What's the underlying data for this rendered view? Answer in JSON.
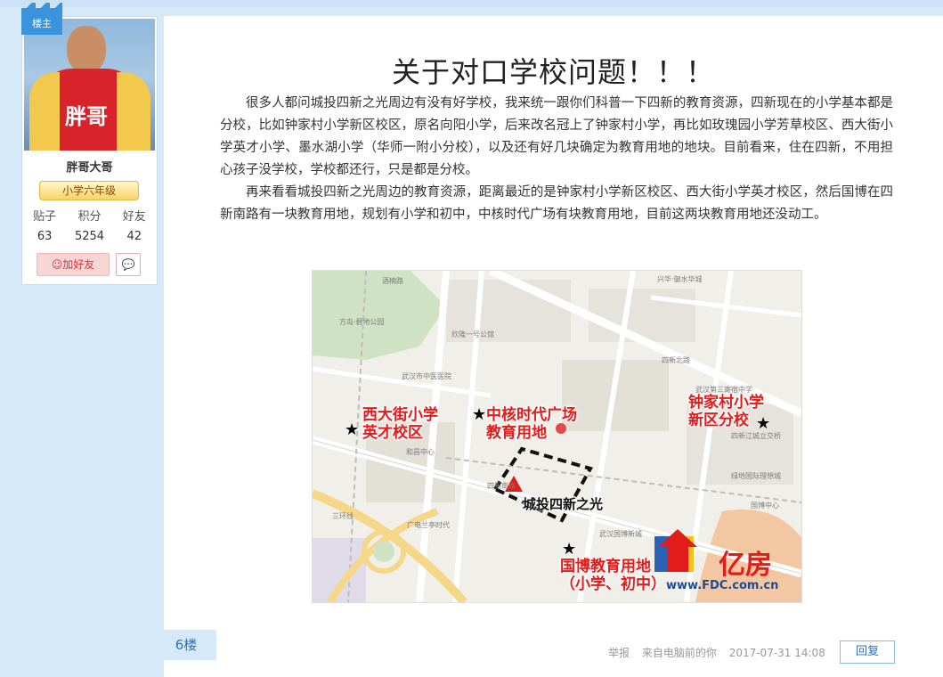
{
  "user": {
    "owner_badge": "楼主",
    "name": "胖哥大哥",
    "avatar_shirt_text": "胖哥",
    "level": "小学六年级",
    "stats_labels": [
      "贴子",
      "积分",
      "好友"
    ],
    "stats_values": [
      "63",
      "5254",
      "42"
    ],
    "add_friend": "加好友"
  },
  "post": {
    "title": "关于对口学校问题！！！",
    "paragraphs": [
      "很多人都问城投四新之光周边有没有好学校，我来统一跟你们科普一下四新的教育资源，四新现在的小学基本都是分校，比如钟家村小学新区校区，原名向阳小学，后来改名冠上了钟家村小学，再比如玫瑰园小学芳草校区、西大街小学英才小学、墨水湖小学（华师一附小分校），以及还有好几块确定为教育用地的地块。目前看来，住在四新，不用担心孩子没学校，学校都还行，只是都是分校。",
      "再来看看城投四新之光周边的教育资源，距离最近的是钟家村小学新区校区、西大街小学英才校区，然后国博在四新南路有一块教育用地，规划有小学和初中，中核时代广场有块教育用地，目前这两块教育用地还没动工。"
    ]
  },
  "map": {
    "labels": {
      "xidajie_1": "西大街小学",
      "xidajie_2": "英才校区",
      "zhonghe_1": "中核时代广场",
      "zhonghe_2": "教育用地",
      "zhongjiacun_1": "钟家村小学",
      "zhongjiacun_2": "新区分校",
      "guobo_1": "国博教育用地",
      "guobo_2": "（小学、初中）",
      "site": "城投四新之光"
    },
    "streets": {
      "s1": "酒楠路",
      "s2": "兴华·御水华城",
      "s3": "方岛·碧地公园",
      "s4": "欣隆一号公馆",
      "s5": "四新北路",
      "s6": "武汉市中医医院",
      "s7": "武汉第三寄宿中学",
      "s8": "和昌中心",
      "s9": "四新南路",
      "s10": "广电兰亭时代",
      "s11": "三环线",
      "s12": "四新江城立交桥",
      "s13": "绿地国际理想城",
      "s14": "国博中心",
      "s15": "武汉国博新城"
    },
    "logo_text": "亿房",
    "logo_url": "www.FDC.com.cn"
  },
  "footer": {
    "floor": "6楼",
    "report": "举报",
    "source": "来自电脑前的你",
    "time": "2017-07-31 14:08",
    "reply": "回复"
  }
}
